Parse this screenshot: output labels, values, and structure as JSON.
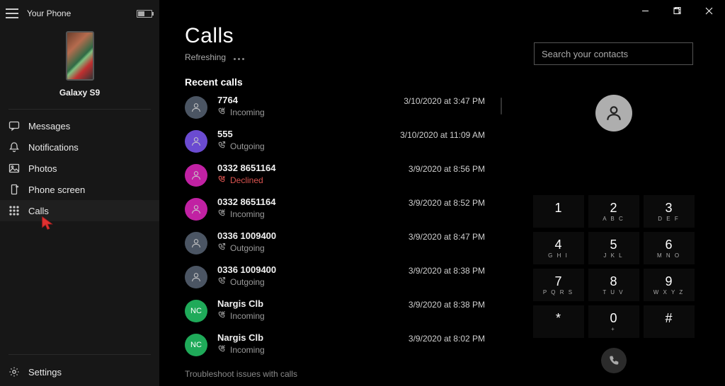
{
  "header": {
    "app_title": "Your Phone"
  },
  "device": {
    "name": "Galaxy S9"
  },
  "nav": {
    "items": [
      {
        "label": "Messages",
        "icon": "chat-icon"
      },
      {
        "label": "Notifications",
        "icon": "bell-icon"
      },
      {
        "label": "Photos",
        "icon": "image-icon"
      },
      {
        "label": "Phone screen",
        "icon": "phone-screen-icon"
      },
      {
        "label": "Calls",
        "icon": "dialpad-icon"
      }
    ],
    "settings_label": "Settings"
  },
  "calls_page": {
    "title": "Calls",
    "refreshing_label": "Refreshing",
    "section_header": "Recent calls",
    "troubleshoot_label": "Troubleshoot issues with calls"
  },
  "calls": [
    {
      "name": "7764",
      "type_label": "Incoming",
      "type": "incoming",
      "time": "3/10/2020 at 3:47 PM",
      "avatar_bg": "#4b5563",
      "initials": ""
    },
    {
      "name": "555",
      "type_label": "Outgoing",
      "type": "outgoing",
      "time": "3/10/2020 at 11:09 AM",
      "avatar_bg": "#6b4bd1",
      "initials": ""
    },
    {
      "name": "0332 8651164",
      "type_label": "Declined",
      "type": "declined",
      "time": "3/9/2020 at 8:56 PM",
      "avatar_bg": "#c121a3",
      "initials": ""
    },
    {
      "name": "0332 8651164",
      "type_label": "Incoming",
      "type": "incoming",
      "time": "3/9/2020 at 8:52 PM",
      "avatar_bg": "#c121a3",
      "initials": ""
    },
    {
      "name": "0336 1009400",
      "type_label": "Outgoing",
      "type": "outgoing",
      "time": "3/9/2020 at 8:47 PM",
      "avatar_bg": "#4b5563",
      "initials": ""
    },
    {
      "name": "0336 1009400",
      "type_label": "Outgoing",
      "type": "outgoing",
      "time": "3/9/2020 at 8:38 PM",
      "avatar_bg": "#4b5563",
      "initials": ""
    },
    {
      "name": "Nargis Clb",
      "type_label": "Incoming",
      "type": "incoming",
      "time": "3/9/2020 at 8:38 PM",
      "avatar_bg": "#1faa59",
      "initials": "NC"
    },
    {
      "name": "Nargis Clb",
      "type_label": "Incoming",
      "type": "incoming",
      "time": "3/9/2020 at 8:02 PM",
      "avatar_bg": "#1faa59",
      "initials": "NC"
    }
  ],
  "dialer": {
    "search_placeholder": "Search your contacts",
    "keys": [
      {
        "num": "1",
        "let": ""
      },
      {
        "num": "2",
        "let": "A B C"
      },
      {
        "num": "3",
        "let": "D E F"
      },
      {
        "num": "4",
        "let": "G H I"
      },
      {
        "num": "5",
        "let": "J K L"
      },
      {
        "num": "6",
        "let": "M N O"
      },
      {
        "num": "7",
        "let": "P Q R S"
      },
      {
        "num": "8",
        "let": "T U V"
      },
      {
        "num": "9",
        "let": "W X Y Z"
      },
      {
        "num": "*",
        "let": ""
      },
      {
        "num": "0",
        "let": "+"
      },
      {
        "num": "#",
        "let": ""
      }
    ]
  }
}
